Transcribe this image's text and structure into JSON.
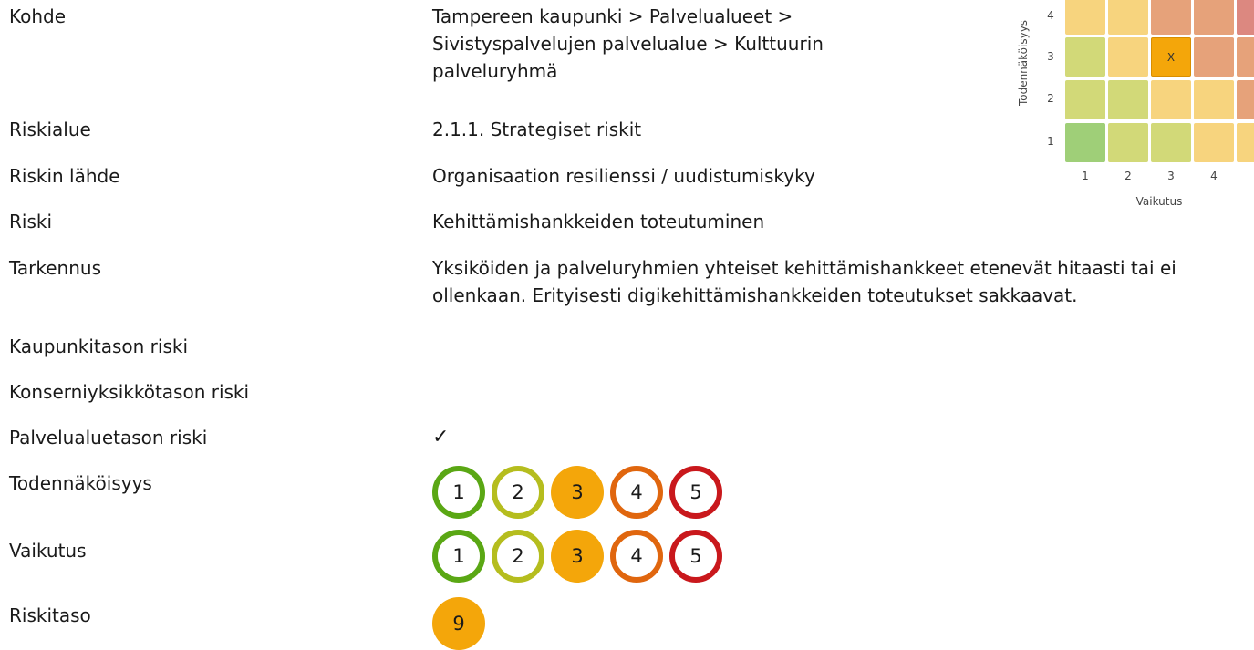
{
  "fields": {
    "kohde": {
      "label": "Kohde",
      "value": "Tampereen kaupunki > Palvelualueet > Sivistyspalvelujen palvelualue > Kulttuurin palveluryhmä"
    },
    "riskialue": {
      "label": "Riskialue",
      "value": "2.1.1. Strategiset riskit"
    },
    "lahde": {
      "label": "Riskin lähde",
      "value": "Organisaation resilienssi / uudistumiskyky"
    },
    "riski": {
      "label": "Riski",
      "value": "Kehittämishankkeiden toteutuminen"
    },
    "tarkennus": {
      "label": "Tarkennus",
      "value": "Yksiköiden ja palveluryhmien yhteiset kehittämishankkeet etenevät hitaasti tai ei ollenkaan. Erityisesti digikehittämishankkeiden toteutukset sakkaavat."
    },
    "kaupunki": {
      "label": "Kaupunkitason riski",
      "value": ""
    },
    "konserni": {
      "label": "Konserniyksikkötason riski",
      "value": ""
    },
    "palvelualue": {
      "label": "Palvelualuetason riski",
      "value": "✓"
    },
    "todennakoisyys": {
      "label": "Todennäköisyys",
      "selected": 3,
      "options": [
        "1",
        "2",
        "3",
        "4",
        "5"
      ]
    },
    "vaikutus": {
      "label": "Vaikutus",
      "selected": 3,
      "options": [
        "1",
        "2",
        "3",
        "4",
        "5"
      ]
    },
    "riskitaso": {
      "label": "Riskitaso",
      "value": "9"
    }
  },
  "matrix": {
    "ylabel": "Todennäköisyys",
    "xlabel": "Vaikutus",
    "yticks": [
      "4",
      "3",
      "2",
      "1"
    ],
    "xticks": [
      "1",
      "2",
      "3",
      "4"
    ],
    "marker": "X",
    "colors": {
      "green": "#9fcf78",
      "lime": "#d2d978",
      "yellow": "#f7d47e",
      "orange": "#f0b074",
      "salmon": "#e6a27a",
      "red": "#dc8880",
      "selected": "#f4a60a"
    }
  }
}
